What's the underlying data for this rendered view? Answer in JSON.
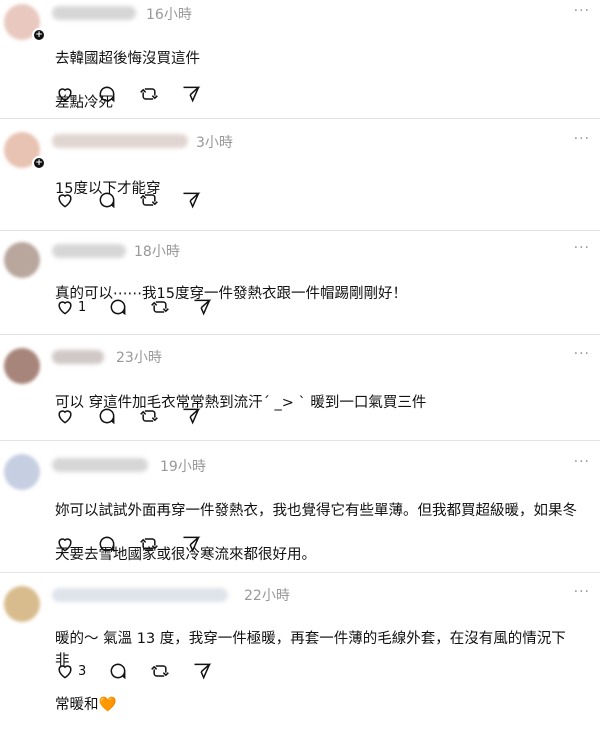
{
  "comments": [
    {
      "time": "16小時",
      "lines": [
        "去韓國超後悔沒買這件",
        "差點冷死"
      ],
      "likes": "",
      "avatar_color": "#e9c9bf",
      "name_color": "#d9d9d9"
    },
    {
      "time": "3小時",
      "lines": [
        "15度以下才能穿"
      ],
      "likes": "",
      "avatar_color": "#e8c3b3",
      "name_color": "#e0d5d0"
    },
    {
      "time": "18小時",
      "lines": [
        "真的可以⋯⋯我15度穿一件發熱衣跟一件帽踢剛剛好！"
      ],
      "likes": "1",
      "avatar_color": "#b9a79e",
      "name_color": "#d4d4d4"
    },
    {
      "time": "23小時",
      "lines": [
        "可以 穿這件加毛衣常常熱到流汗´ _> ` 暖到一口氣買三件"
      ],
      "likes": "",
      "avatar_color": "#a7857a",
      "name_color": "#cfc8c6"
    },
    {
      "time": "19小時",
      "lines": [
        "妳可以試試外面再穿一件發熱衣，我也覺得它有些單薄。但我都買超級暖，如果冬",
        "天要去雪地國家或很冷寒流來都很好用。"
      ],
      "likes": "",
      "avatar_color": "#c6cfe2",
      "name_color": "#cfcfcf"
    },
    {
      "time": "22小時",
      "lines": [
        "暖的～ 氣溫 13 度，我穿一件極暖，再套一件薄的毛線外套，在沒有風的情況下非",
        "常暖和🧡"
      ],
      "likes": "3",
      "avatar_color": "#d8bc8e",
      "name_color": "#dfe3ea"
    }
  ],
  "more_label": "···"
}
